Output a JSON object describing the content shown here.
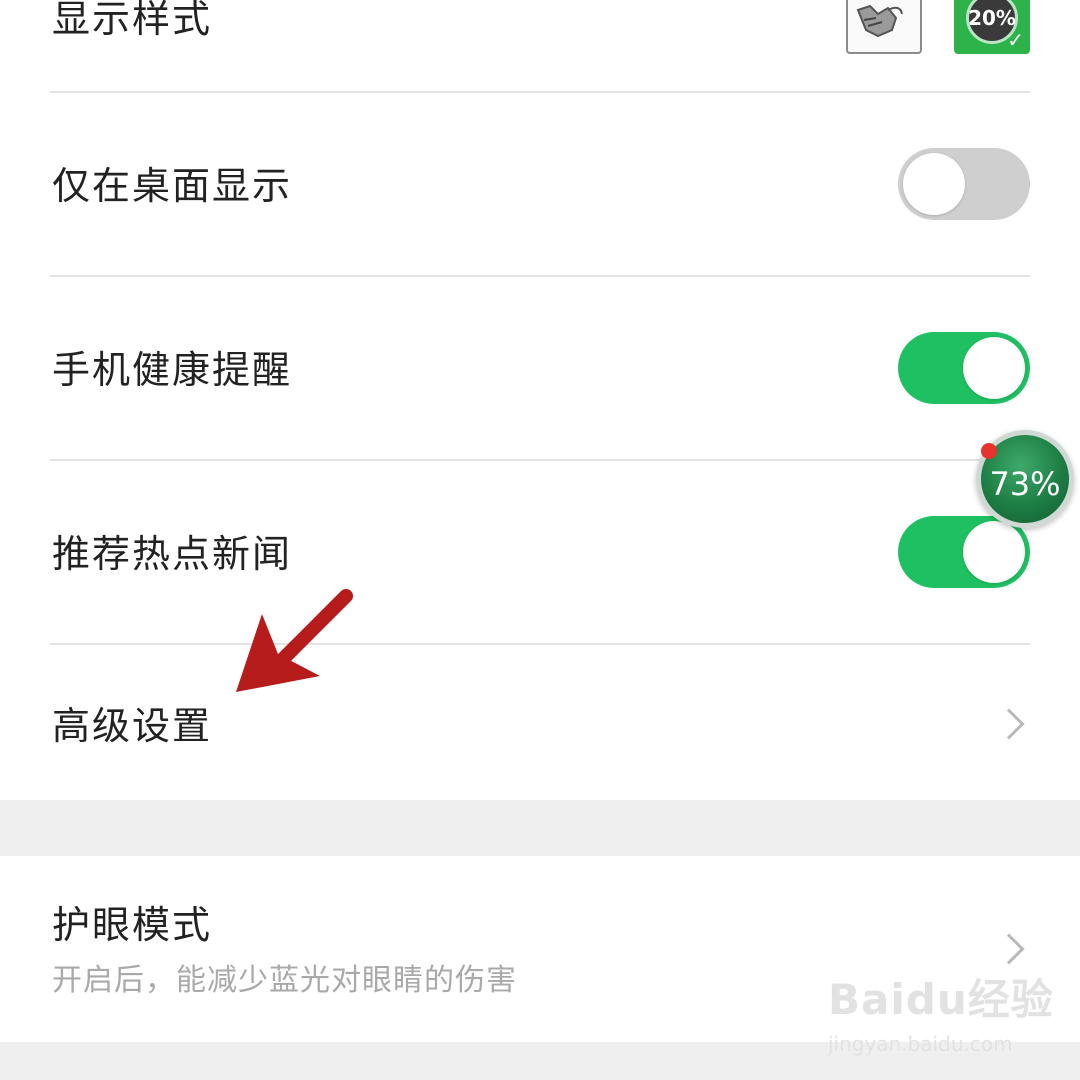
{
  "settings": {
    "display_style": {
      "label": "显示样式",
      "options": [
        {
          "icon": "sticker-style-icon"
        },
        {
          "icon": "percentage-ball-style-icon",
          "text": "20%",
          "selected": true
        }
      ]
    },
    "desktop_only": {
      "label": "仅在桌面显示",
      "enabled": false
    },
    "health_reminder": {
      "label": "手机健康提醒",
      "enabled": true
    },
    "hot_news": {
      "label": "推荐热点新闻",
      "enabled": true
    },
    "advanced": {
      "label": "高级设置"
    },
    "eye_care": {
      "label": "护眼模式",
      "description": "开启后，能减少蓝光对眼睛的伤害"
    }
  },
  "floating_ball": {
    "text": "73%"
  },
  "watermark": {
    "brand": "Baidu经验",
    "url": "jingyan.baidu.com"
  },
  "colors": {
    "toggle_on": "#1fc062",
    "toggle_off": "#cfcfcf",
    "arrow": "#b71c1c"
  }
}
